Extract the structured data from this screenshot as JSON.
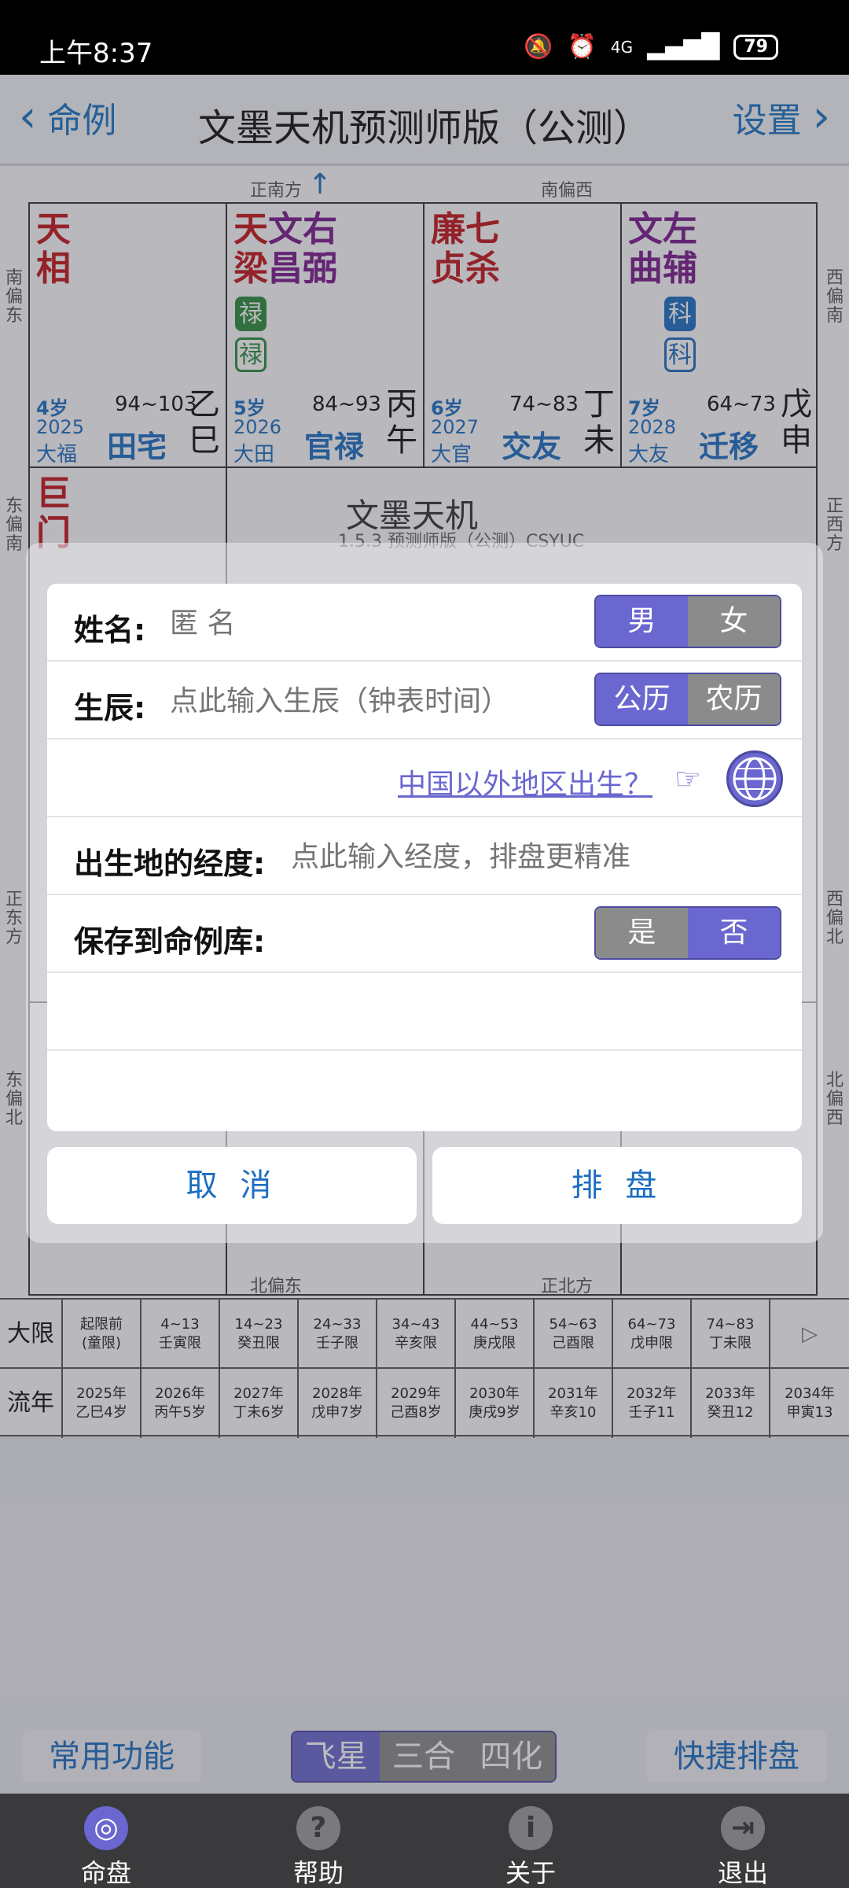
{
  "status": {
    "time": "上午8:37",
    "battery": "79",
    "network": "4G"
  },
  "header": {
    "back_label": "命例",
    "title": "文墨天机预测师版（公测）",
    "settings_label": "设置"
  },
  "chart": {
    "directions": {
      "top_left": "正南方",
      "top_right": "南偏西",
      "left_1": "南偏东",
      "left_2": "东偏南",
      "left_3": "正东方",
      "left_4": "东偏北",
      "right_1": "西偏南",
      "right_2": "正西方",
      "right_3": "西偏北",
      "right_4": "北偏西",
      "bottom_left": "北偏东",
      "bottom_right": "正北方"
    },
    "cells": [
      {
        "stars": [
          "天相"
        ],
        "age": "4岁",
        "range": "94~103",
        "year": "2025",
        "da": "大福",
        "palace": "田宅",
        "gz": "乙巳"
      },
      {
        "stars": [
          "天梁",
          "文昌",
          "右弼"
        ],
        "age": "5岁",
        "range": "84~93",
        "year": "2026",
        "da": "大田",
        "palace": "官禄",
        "gz": "丙午",
        "badges": [
          "禄",
          "禄"
        ]
      },
      {
        "stars": [
          "廉贞",
          "七杀"
        ],
        "age": "6岁",
        "range": "74~83",
        "year": "2027",
        "da": "大官",
        "palace": "交友",
        "gz": "丁未"
      },
      {
        "stars": [
          "文曲",
          "左辅"
        ],
        "age": "7岁",
        "range": "64~73",
        "year": "2028",
        "da": "大友",
        "palace": "迁移",
        "gz": "戊申",
        "badges": [
          "科",
          "科"
        ]
      }
    ],
    "left_cell_stars": "巨门",
    "center_name": "文墨天机",
    "center_sub": "1.5.3 预测师版（公测）CSYUC"
  },
  "dialog": {
    "name_label": "姓名:",
    "name_placeholder": "匿 名",
    "gender": [
      "男",
      "女"
    ],
    "birth_label": "生辰:",
    "birth_placeholder": "点此输入生辰（钟表时间）",
    "calendar": [
      "公历",
      "农历"
    ],
    "overseas_link": "中国以外地区出生？",
    "longitude_label": "出生地的经度:",
    "longitude_placeholder": "点此输入经度，排盘更精准",
    "save_label": "保存到命例库:",
    "save_opts": [
      "是",
      "否"
    ],
    "cancel": "取 消",
    "submit": "排 盘"
  },
  "daxian": {
    "label": "大限",
    "cells": [
      [
        "起限前",
        "(童限)"
      ],
      [
        "4~13",
        "壬寅限"
      ],
      [
        "14~23",
        "癸丑限"
      ],
      [
        "24~33",
        "壬子限"
      ],
      [
        "34~43",
        "辛亥限"
      ],
      [
        "44~53",
        "庚戌限"
      ],
      [
        "54~63",
        "己酉限"
      ],
      [
        "64~73",
        "戊申限"
      ],
      [
        "74~83",
        "丁未限"
      ]
    ],
    "next": "▷"
  },
  "liunian": {
    "label": "流年",
    "cells": [
      [
        "2025年",
        "乙巳4岁"
      ],
      [
        "2026年",
        "丙午5岁"
      ],
      [
        "2027年",
        "丁未6岁"
      ],
      [
        "2028年",
        "戊申7岁"
      ],
      [
        "2029年",
        "己酉8岁"
      ],
      [
        "2030年",
        "庚戌9岁"
      ],
      [
        "2031年",
        "辛亥10"
      ],
      [
        "2032年",
        "壬子11"
      ],
      [
        "2033年",
        "癸丑12"
      ],
      [
        "2034年",
        "甲寅13"
      ]
    ]
  },
  "controls": {
    "common": "常用功能",
    "modes": [
      "飞星",
      "三合",
      "四化"
    ],
    "quick": "快捷排盘"
  },
  "nav": [
    {
      "label": "命盘",
      "icon": "target-icon"
    },
    {
      "label": "帮助",
      "icon": "help-icon"
    },
    {
      "label": "关于",
      "icon": "info-icon"
    },
    {
      "label": "退出",
      "icon": "exit-icon"
    }
  ],
  "colors": {
    "accent": "#6a67d0",
    "link": "#1d6ec2",
    "star_red": "#c3141b",
    "star_purple": "#7a1a8c"
  }
}
